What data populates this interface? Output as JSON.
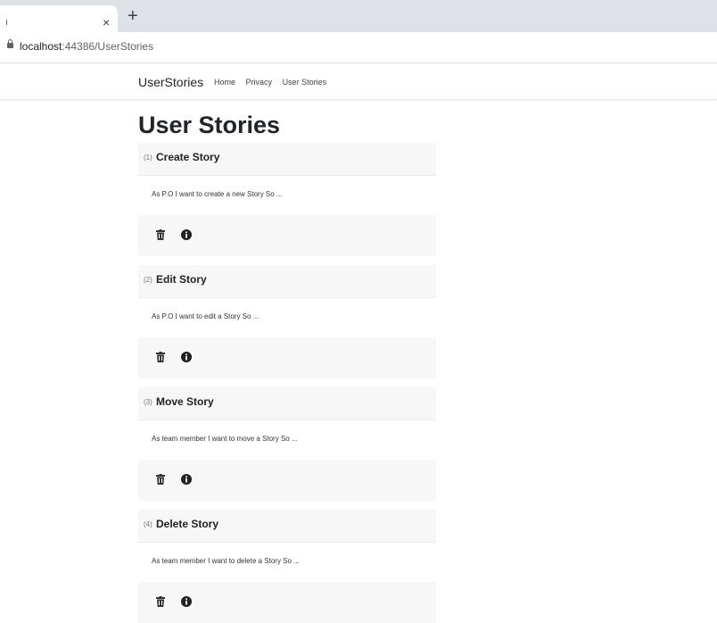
{
  "browser": {
    "tab_edge": "ı",
    "tab_close": "×",
    "new_tab": "+",
    "url_host": "localhost",
    "url_rest": ":44386/UserStories"
  },
  "navbar": {
    "brand": "UserStories",
    "links": [
      "Home",
      "Privacy",
      "User Stories"
    ]
  },
  "page": {
    "title": "User Stories"
  },
  "stories": [
    {
      "id": "(1)",
      "title": "Create Story",
      "description": "As P.O I want to create a new Story So ..."
    },
    {
      "id": "(2)",
      "title": "Edit Story",
      "description": "As P.O I want to edit a Story So ..."
    },
    {
      "id": "(3)",
      "title": "Move Story",
      "description": "As team member I want to move a Story So ..."
    },
    {
      "id": "(4)",
      "title": "Delete Story",
      "description": "As team member I want to delete a Story So ..."
    }
  ],
  "icons": {
    "delete": "trash-icon",
    "details": "info-icon"
  },
  "colors": {
    "card_background": "#f7f7f7",
    "tabstrip": "#dee1e6"
  }
}
